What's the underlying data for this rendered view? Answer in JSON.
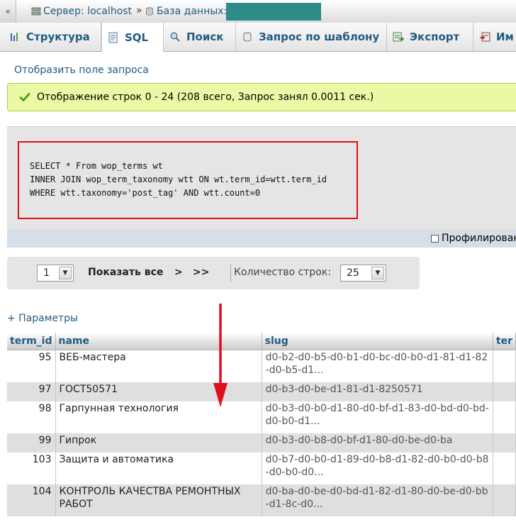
{
  "breadcrumb": {
    "toggle_symbol": "«",
    "server_label": "Сервер: localhost",
    "separator": "»",
    "database_label": "База данных:"
  },
  "tabs": [
    {
      "label": "Структура",
      "icon": "structure-icon"
    },
    {
      "label": "SQL",
      "icon": "sql-icon",
      "active": true
    },
    {
      "label": "Поиск",
      "icon": "search-icon"
    },
    {
      "label": "Запрос по шаблону",
      "icon": "query-icon"
    },
    {
      "label": "Экспорт",
      "icon": "export-icon"
    },
    {
      "label": "Им",
      "icon": "import-icon"
    }
  ],
  "toggle_query_link": "Отобразить поле запроса",
  "success_message": "Отображение строк 0 - 24 (208 всего, Запрос занял 0.0011 сек.)",
  "sql_query": "SELECT * From wop_terms wt\nINNER JOIN wop_term_taxonomy wtt ON wt.term_id=wtt.term_id\nWHERE wtt.taxonomy='post_tag' AND wtt.count=0",
  "profiling_label": "Профилирован",
  "navigation": {
    "page_value": "1",
    "show_all_label": "Показать все",
    "next_label": ">",
    "last_label": ">>",
    "rows_label": "Количество строк:",
    "rows_value": "25"
  },
  "parameters_link": "+ Параметры",
  "table": {
    "columns": [
      "term_id",
      "name",
      "slug",
      "ter"
    ],
    "rows": [
      {
        "term_id": "95",
        "name": "ВЕБ-мастера",
        "slug": "d0-b2-d0-b5-d0-b1-d0-bc-d0-b0-d1-81-d1-82-d0-b5-d1..."
      },
      {
        "term_id": "97",
        "name": "ГОСТ50571",
        "slug": "d0-b3-d0-be-d1-81-d1-8250571"
      },
      {
        "term_id": "98",
        "name": "Гарпунная технология",
        "slug": "d0-b3-d0-b0-d1-80-d0-bf-d1-83-d0-bd-d0-bd-d0-b0-d1..."
      },
      {
        "term_id": "99",
        "name": "Гипрок",
        "slug": "d0-b3-d0-b8-d0-bf-d1-80-d0-be-d0-ba"
      },
      {
        "term_id": "103",
        "name": "Защита и автоматика",
        "slug": "d0-b7-d0-b0-d1-89-d0-b8-d1-82-d0-b0-d0-b8-d0-b0-d0..."
      },
      {
        "term_id": "104",
        "name": "КОНТРОЛЬ КАЧЕСТВА РЕМОНТНЫХ РАБОТ",
        "slug": "d0-ba-d0-be-d0-bd-d1-82-d1-80-d0-be-d0-bb-d1-8c-d0..."
      }
    ]
  },
  "colors": {
    "link": "#235a81",
    "success_bg": "#ebf8a4",
    "annotation_red": "#e0101a",
    "redaction": "#2e8b87"
  }
}
